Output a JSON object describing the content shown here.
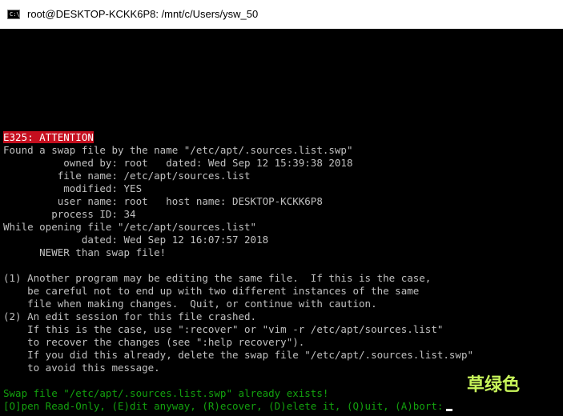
{
  "window": {
    "title": "root@DESKTOP-KCKK6P8: /mnt/c/Users/ysw_50",
    "icon": "console-icon"
  },
  "terminal": {
    "lines": [
      {
        "kind": "attention",
        "text": "E325: ATTENTION"
      },
      {
        "kind": "normal",
        "text": "Found a swap file by the name \"/etc/apt/.sources.list.swp\""
      },
      {
        "kind": "normal",
        "text": "          owned by: root   dated: Wed Sep 12 15:39:38 2018"
      },
      {
        "kind": "normal",
        "text": "         file name: /etc/apt/sources.list"
      },
      {
        "kind": "normal",
        "text": "          modified: YES"
      },
      {
        "kind": "normal",
        "text": "         user name: root   host name: DESKTOP-KCKK6P8"
      },
      {
        "kind": "normal",
        "text": "        process ID: 34"
      },
      {
        "kind": "normal",
        "text": "While opening file \"/etc/apt/sources.list\""
      },
      {
        "kind": "normal",
        "text": "             dated: Wed Sep 12 16:07:57 2018"
      },
      {
        "kind": "normal",
        "text": "      NEWER than swap file!"
      },
      {
        "kind": "normal",
        "text": ""
      },
      {
        "kind": "normal",
        "text": "(1) Another program may be editing the same file.  If this is the case,"
      },
      {
        "kind": "normal",
        "text": "    be careful not to end up with two different instances of the same"
      },
      {
        "kind": "normal",
        "text": "    file when making changes.  Quit, or continue with caution."
      },
      {
        "kind": "normal",
        "text": "(2) An edit session for this file crashed."
      },
      {
        "kind": "normal",
        "text": "    If this is the case, use \":recover\" or \"vim -r /etc/apt/sources.list\""
      },
      {
        "kind": "normal",
        "text": "    to recover the changes (see \":help recovery\")."
      },
      {
        "kind": "normal",
        "text": "    If you did this already, delete the swap file \"/etc/apt/.sources.list.swp\""
      },
      {
        "kind": "normal",
        "text": "    to avoid this message."
      },
      {
        "kind": "normal",
        "text": ""
      },
      {
        "kind": "green",
        "text": "Swap file \"/etc/apt/.sources.list.swp\" already exists!"
      },
      {
        "kind": "prompt",
        "text": "[O]pen Read-Only, (E)dit anyway, (R)ecover, (D)elete it, (Q)uit, (A)bort:"
      }
    ]
  },
  "watermark": "草绿色",
  "colors": {
    "background": "#000000",
    "text": "#c0c0c0",
    "attention_bg": "#c50f1f",
    "green": "#13a10e",
    "watermark": "#c8f55a"
  }
}
